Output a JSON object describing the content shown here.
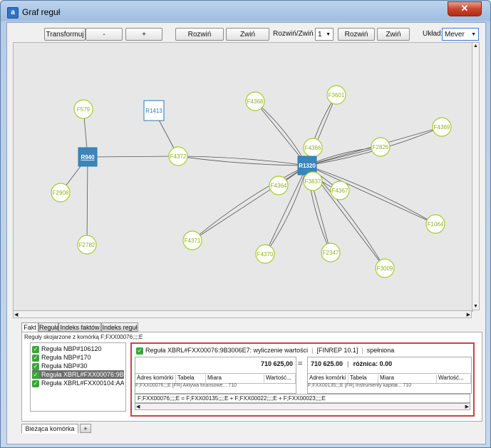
{
  "window": {
    "title": "Graf reguł",
    "icon_letter": "a",
    "close_glyph": "✕"
  },
  "toolbar": {
    "transform_label": "Transformuj",
    "minus_label": "-",
    "plus_label": "+",
    "expand_all_label": "Rozwiń wszystkie",
    "collapse_all_label": "Zwiń wszystkie",
    "expand_by_label": "Rozwiń/Zwiń o:",
    "expand_by_value": "1",
    "expand_label": "Rozwiń",
    "collapse_label": "Zwiń",
    "layout_label": "Układ:",
    "layout_value": "Mever"
  },
  "graph": {
    "nodes": [
      {
        "id": "F579",
        "type": "fact"
      },
      {
        "id": "R1413",
        "type": "rule"
      },
      {
        "id": "R940",
        "type": "rule-selected"
      },
      {
        "id": "F4372",
        "type": "fact"
      },
      {
        "id": "F2908",
        "type": "fact"
      },
      {
        "id": "F2782",
        "type": "fact"
      },
      {
        "id": "F4368",
        "type": "fact"
      },
      {
        "id": "F3601",
        "type": "fact"
      },
      {
        "id": "F4369",
        "type": "fact"
      },
      {
        "id": "F4366",
        "type": "fact"
      },
      {
        "id": "F2826",
        "type": "fact"
      },
      {
        "id": "R1320",
        "type": "rule-selected"
      },
      {
        "id": "F4364",
        "type": "fact"
      },
      {
        "id": "F3837",
        "type": "fact"
      },
      {
        "id": "F4367",
        "type": "fact"
      },
      {
        "id": "F1064",
        "type": "fact"
      },
      {
        "id": "F4371",
        "type": "fact"
      },
      {
        "id": "F4370",
        "type": "fact"
      },
      {
        "id": "F2347",
        "type": "fact"
      },
      {
        "id": "F3009",
        "type": "fact"
      }
    ],
    "colors": {
      "fact_border": "#a8cc2a",
      "rule_border": "#2e7ab0",
      "rule_fill": "#3a86b8",
      "edge": "#555555"
    }
  },
  "tabs": [
    "Fakt",
    "Reguła",
    "Indeks faktów",
    "Indeks reguł"
  ],
  "panel": {
    "caption": "Reguły skojarzone z komórką F;FXX00076;;;;E",
    "rules": [
      {
        "label": "Reguła NBP#106120",
        "selected": false
      },
      {
        "label": "Reguła NBP#170",
        "selected": false
      },
      {
        "label": "Reguła NBP#30",
        "selected": false
      },
      {
        "label": "Reguła XBRL#FXX00076:9B3006E7",
        "selected": true
      },
      {
        "label": "Reguła XBRL#FXX00104:AA52D4E",
        "selected": false
      }
    ],
    "detail": {
      "rule": "Reguła XBRL#FXX00076:9B3006E7: wyliczenie wartości",
      "template": "[FINREP 10.1]",
      "status": "spełniona",
      "left_value": "710 625,00",
      "equals": "=",
      "right_value": "710 625.00",
      "difference": "różnica: 0.00",
      "columns": [
        "Adres komórki",
        "Tabela",
        "Miara",
        "Wartość..."
      ],
      "left_row": "F;FXX00076;;;E  [FR]  Aktywa finansowe...  710",
      "right_row": "F;FXX00135;;;E  [FR]  Instrumenty kapitał...  710",
      "formula": "F;FXX00076;;;;E = F;FXX00135;;;;E + F;FXX00022;;;;E + F;FXX00023;;;;E"
    }
  },
  "bottom_tabs": [
    "Bieżąca komórka",
    "+"
  ]
}
